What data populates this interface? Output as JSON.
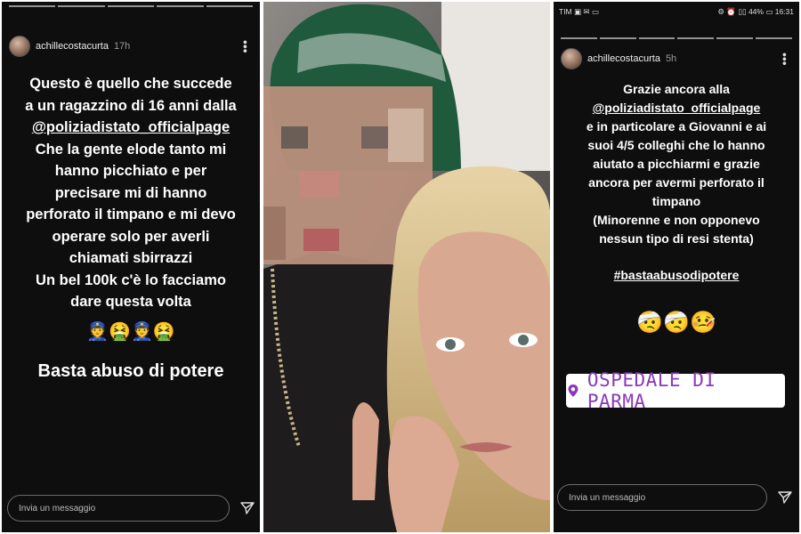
{
  "left": {
    "username": "achillecostacurta",
    "time": "17h",
    "story": {
      "l1": "Questo è quello che succede",
      "l2": "a un ragazzino di 16 anni dalla",
      "l3": "@poliziadistato_officialpage",
      "l4": "Che la gente elode tanto mi",
      "l5": "hanno picchiato e per",
      "l6": "precisare mi di hanno",
      "l7": "perforato il timpano e mi devo",
      "l8": "operare solo per averli",
      "l9": "chiamati sbirrazzi",
      "l10": "Un bel 100k c'è lo facciamo",
      "l11": "dare questa volta",
      "emojis": "👮🤮👮🤮",
      "closing": "Basta abuso di potere"
    },
    "message_placeholder": "Invia un messaggio"
  },
  "right": {
    "status_left": "TIM ▣ ✉ ▭",
    "status_right": "⚙ ⏰ ▯▯ 44% ▭ 16:31",
    "username": "achillecostacurta",
    "time": "5h",
    "story": {
      "l1": "Grazie ancora alla",
      "l2": "@poliziadistato_officialpage",
      "l3": "e in particolare a Giovanni e ai",
      "l4": "suoi 4/5 colleghi che lo hanno",
      "l5": "aiutato a picchiarmi e grazie",
      "l6": "ancora per avermi perforato il",
      "l7": "timpano",
      "l8": "(Minorenne e non opponevo",
      "l9": "nessun tipo di resi stenta)",
      "hashtag": "#bastaabusodipotere",
      "emojis": "🤕🤕🤒"
    },
    "location": "OSPEDALE DI PARMA",
    "message_placeholder": "Invia un messaggio"
  },
  "icons": {
    "more": "more-vertical-icon",
    "send": "send-icon",
    "pin": "location-pin-icon"
  },
  "colors": {
    "story_bg": "#0e0e0e",
    "location_text": "#8a3ab9",
    "beanie": "#1f5a3c"
  }
}
